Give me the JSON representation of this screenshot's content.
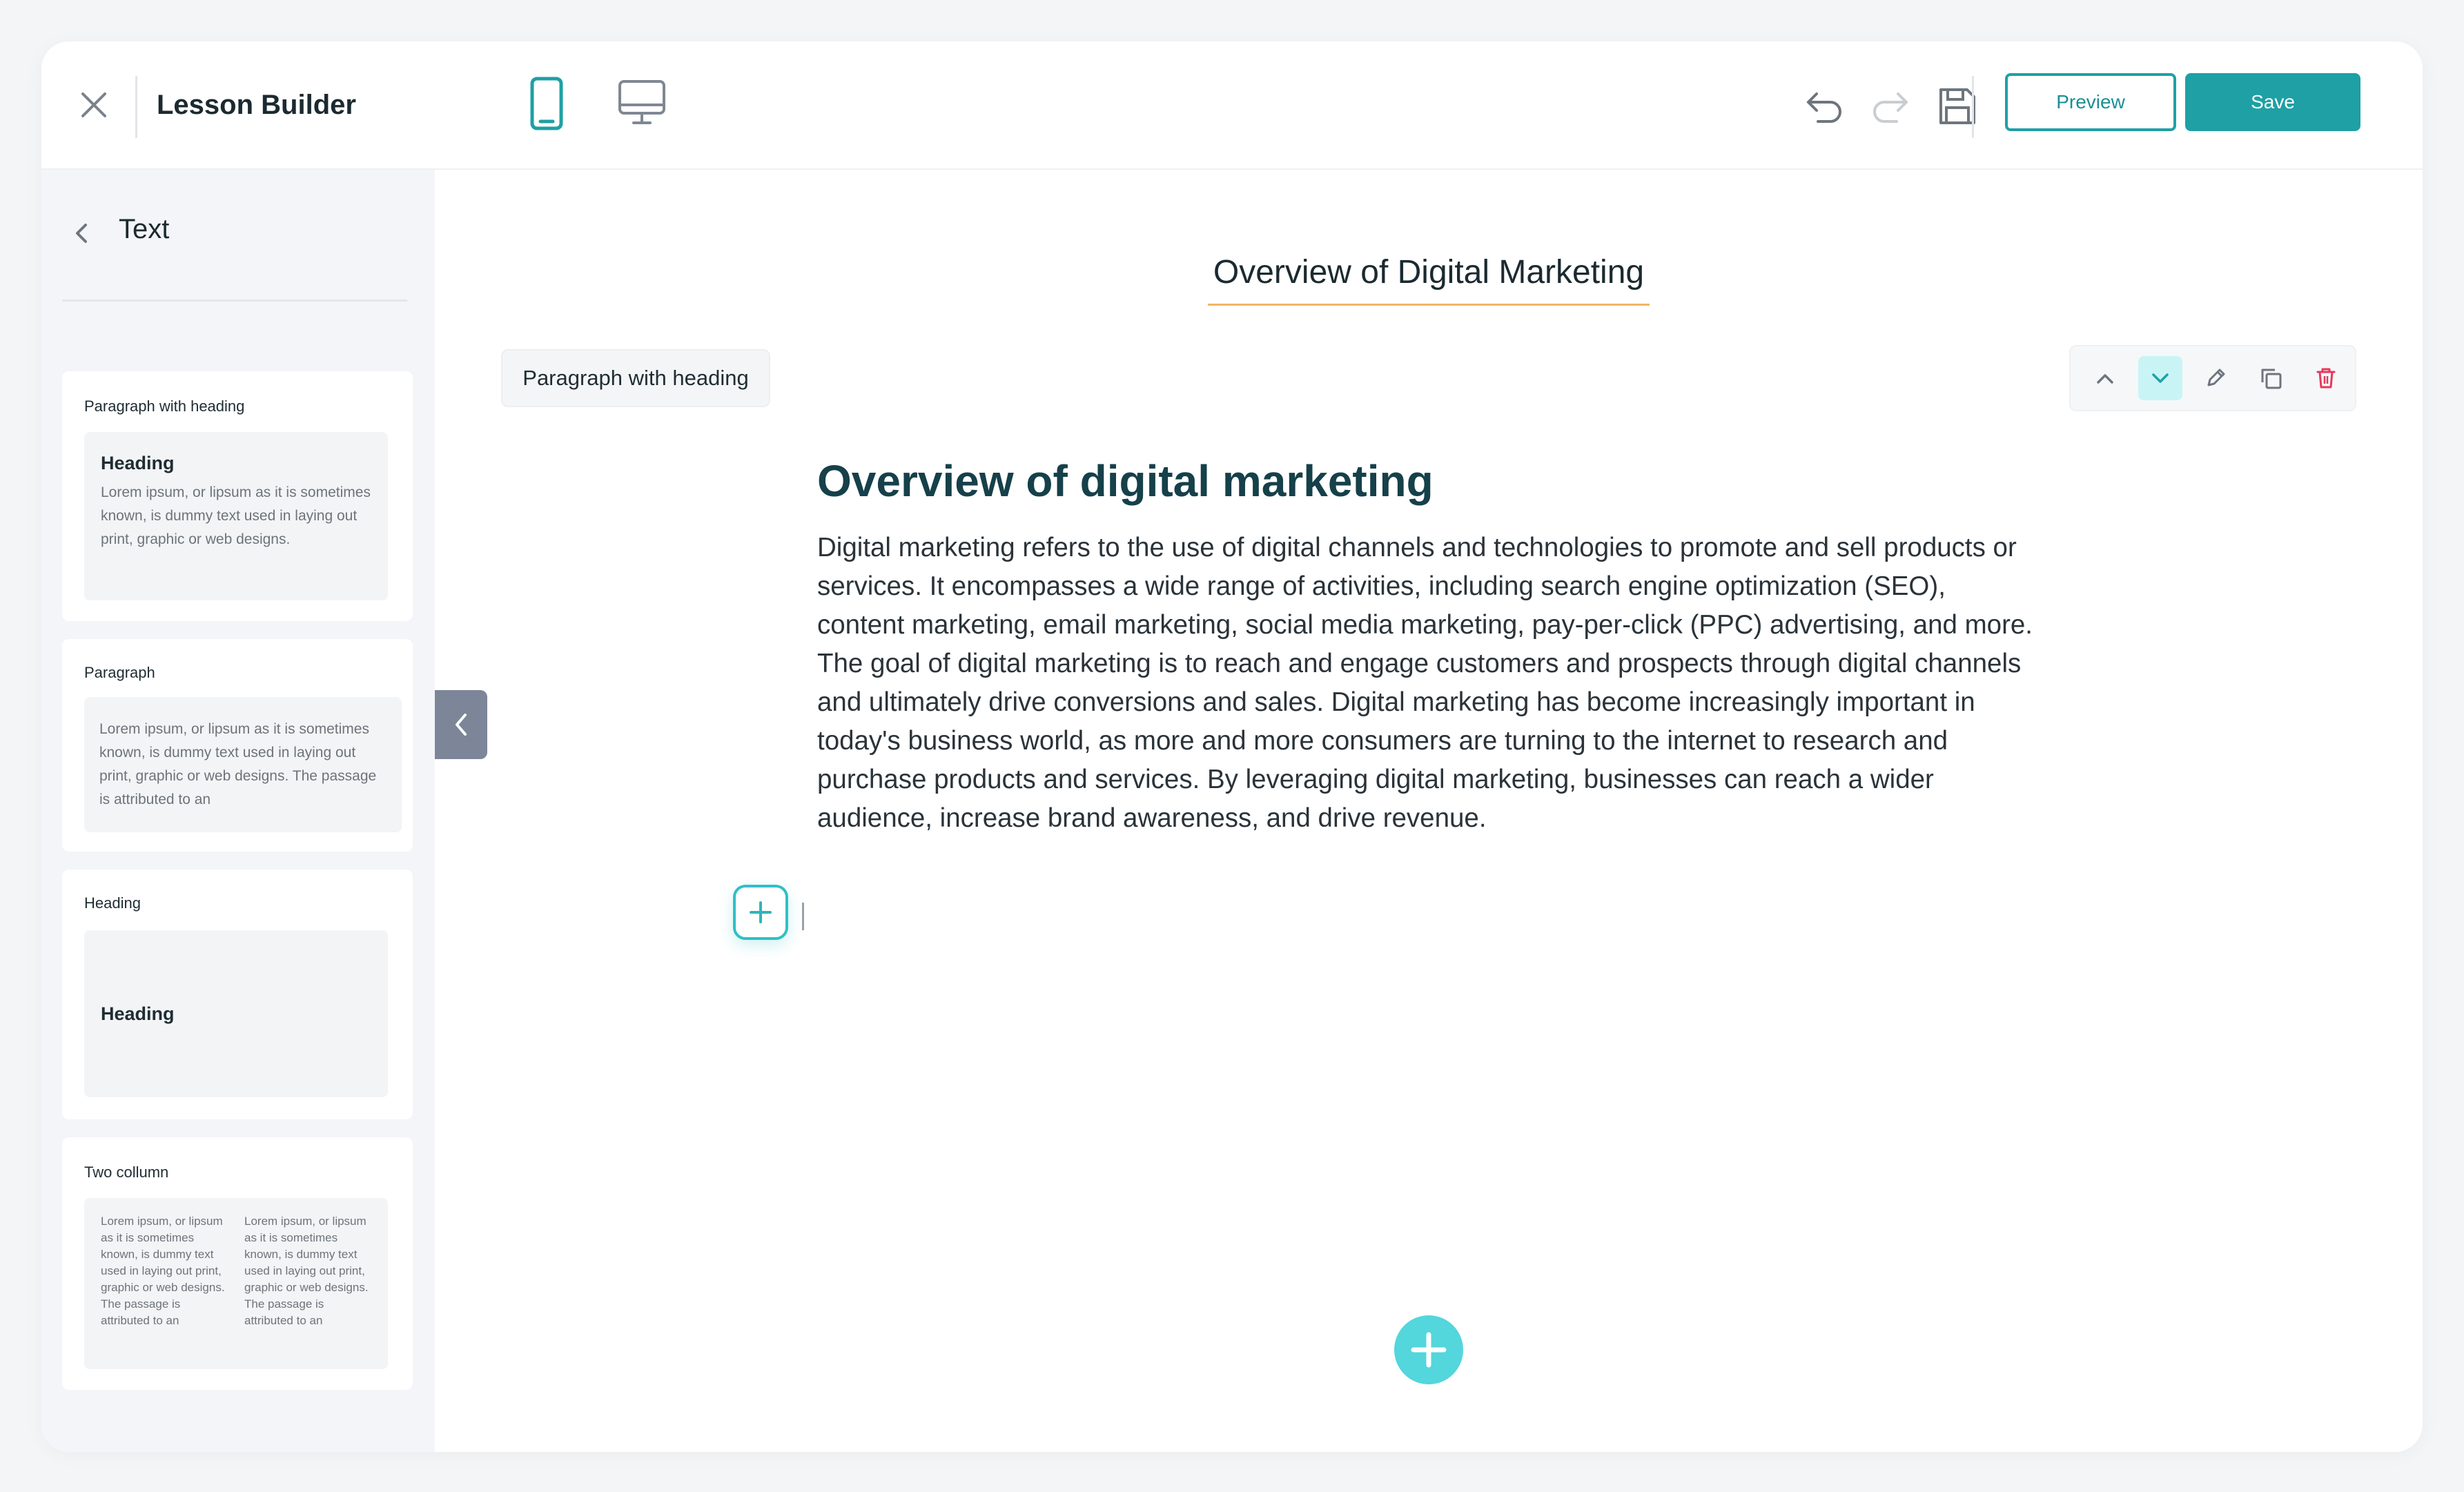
{
  "header": {
    "title": "Lesson Builder",
    "preview_label": "Preview",
    "save_label": "Save"
  },
  "icons": {
    "close": "close-icon",
    "mobile": "mobile-device-icon",
    "desktop": "desktop-device-icon",
    "undo": "undo-icon",
    "redo": "redo-icon",
    "save": "save-disk-icon",
    "back": "chevron-left-icon",
    "move_up": "chevron-up-icon",
    "move_down": "chevron-down-icon",
    "edit": "pencil-icon",
    "duplicate": "copy-icon",
    "delete": "trash-icon",
    "add": "plus-icon"
  },
  "colors": {
    "accent": "#1ea0a5",
    "accent_light": "#53d6dc",
    "delete": "#e5395b",
    "heading": "#16404a",
    "title_underline": "#f3b566"
  },
  "sidebar": {
    "title": "Text",
    "cards": [
      {
        "label": "Paragraph with heading",
        "heading": "Heading",
        "text": "Lorem ipsum, or lipsum as it is sometimes known, is dummy text used in laying out print, graphic or web designs."
      },
      {
        "label": "Paragraph",
        "text": "Lorem ipsum, or lipsum as it is sometimes known, is dummy text used in laying out print, graphic or web designs. The passage is attributed to an"
      },
      {
        "label": "Heading",
        "heading": "Heading"
      },
      {
        "label": "Two collumn",
        "col1": "Lorem ipsum, or lipsum as it is sometimes known, is dummy text used in laying out print, graphic or web designs. The passage is attributed to an",
        "col2": "Lorem ipsum, or lipsum as it is sometimes known, is dummy text used in laying out print, graphic or web designs. The passage is attributed to an"
      }
    ]
  },
  "main": {
    "lesson_title": "Overview of Digital Marketing",
    "block_type": "Paragraph with heading",
    "block": {
      "heading": "Overview of digital marketing",
      "paragraph": "Digital marketing refers to the use of digital channels and technologies to promote and sell products or services. It encompasses a wide range of activities, including search engine optimization (SEO), content marketing, email marketing, social media marketing, pay-per-click (PPC) advertising, and more. The goal of digital marketing is to reach and engage customers and prospects through digital channels and ultimately drive conversions and sales. Digital marketing has become increasingly important in today's business world, as more and more consumers are turning to the internet to research and purchase products and services. By leveraging digital marketing, businesses can reach a wider audience, increase brand awareness, and drive revenue."
    }
  }
}
